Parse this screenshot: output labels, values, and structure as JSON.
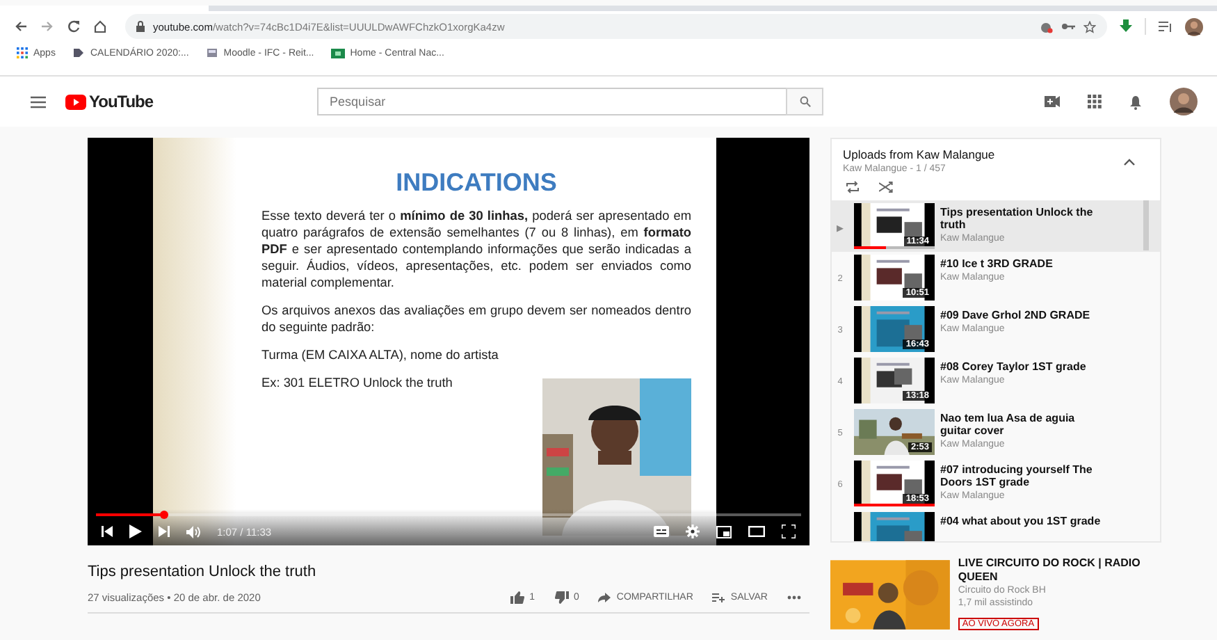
{
  "browser": {
    "url_host": "youtube.com",
    "url_path": "/watch?v=74cBc1D4i7E&list=UUULDwAWFChzkO1xorgKa4zw",
    "bookmarks": [
      {
        "label": "Apps"
      },
      {
        "label": "CALENDÁRIO 2020:..."
      },
      {
        "label": "Moodle - IFC - Reit..."
      },
      {
        "label": "Home - Central Nac..."
      }
    ]
  },
  "header": {
    "logo": "YouTube",
    "search": {
      "placeholder": "Pesquisar"
    }
  },
  "player": {
    "slide": {
      "title": "INDICATIONS",
      "paragraphs": [
        "Esse texto deverá ter o **mínimo de 30 linhas,** poderá ser apresentado em quatro parágrafos de extensão semelhantes (7 ou 8 linhas), em **formato PDF** e ser apresentado contemplando informações que serão indicadas a seguir. Áudios, vídeos, apresentações, etc. podem ser enviados como material complementar.",
        "Os arquivos anexos das avaliações em grupo devem ser nomeados dentro do seguinte padrão:",
        "Turma (EM CAIXA ALTA), nome do artista",
        "Ex: 301 ELETRO Unlock the truth"
      ]
    },
    "time": "1:07 / 11:33",
    "progress": {
      "level": 0.097
    }
  },
  "video": {
    "title": "Tips presentation Unlock the truth",
    "meta": "27 visualizações • 20 de abr. de 2020",
    "likes": "1",
    "dislikes": "0",
    "actions": [
      {
        "kind": "share",
        "label": "COMPARTILHAR"
      },
      {
        "kind": "save",
        "label": "SALVAR"
      }
    ]
  },
  "playlist": {
    "title": "Uploads from Kaw Malangue",
    "subtitle": "Kaw Malangue - 1 / 457",
    "items": [
      {
        "index": "▶",
        "title": "Tips presentation Unlock the truth",
        "channel": "Kaw Malangue",
        "duration": "11:34",
        "selected": true,
        "level": 0.4
      },
      {
        "index": "2",
        "title": "#10 Ice t 3RD GRADE",
        "channel": "Kaw Malangue",
        "duration": "10:51",
        "selected": false
      },
      {
        "index": "3",
        "title": "#09 Dave Grhol 2ND GRADE",
        "channel": "Kaw Malangue",
        "duration": "16:43",
        "selected": false
      },
      {
        "index": "4",
        "title": "#08 Corey Taylor 1ST grade",
        "channel": "Kaw Malangue",
        "duration": "13:18",
        "selected": false
      },
      {
        "index": "5",
        "title": "Nao tem lua Asa de aguia guitar cover",
        "channel": "Kaw Malangue",
        "duration": "2:53",
        "selected": false
      },
      {
        "index": "6",
        "title": "#07 introducing yourself The Doors 1ST grade",
        "channel": "Kaw Malangue",
        "duration": "18:53",
        "selected": false,
        "level": 1
      },
      {
        "title": "#04 what about you 1ST grade",
        "selected": false
      }
    ]
  },
  "live": {
    "title": "LIVE CIRCUITO DO ROCK | RADIO QUEEN",
    "channel": "Circuito do Rock BH",
    "viewers": "1,7 mil assistindo",
    "badge": "AO VIVO AGORA"
  }
}
